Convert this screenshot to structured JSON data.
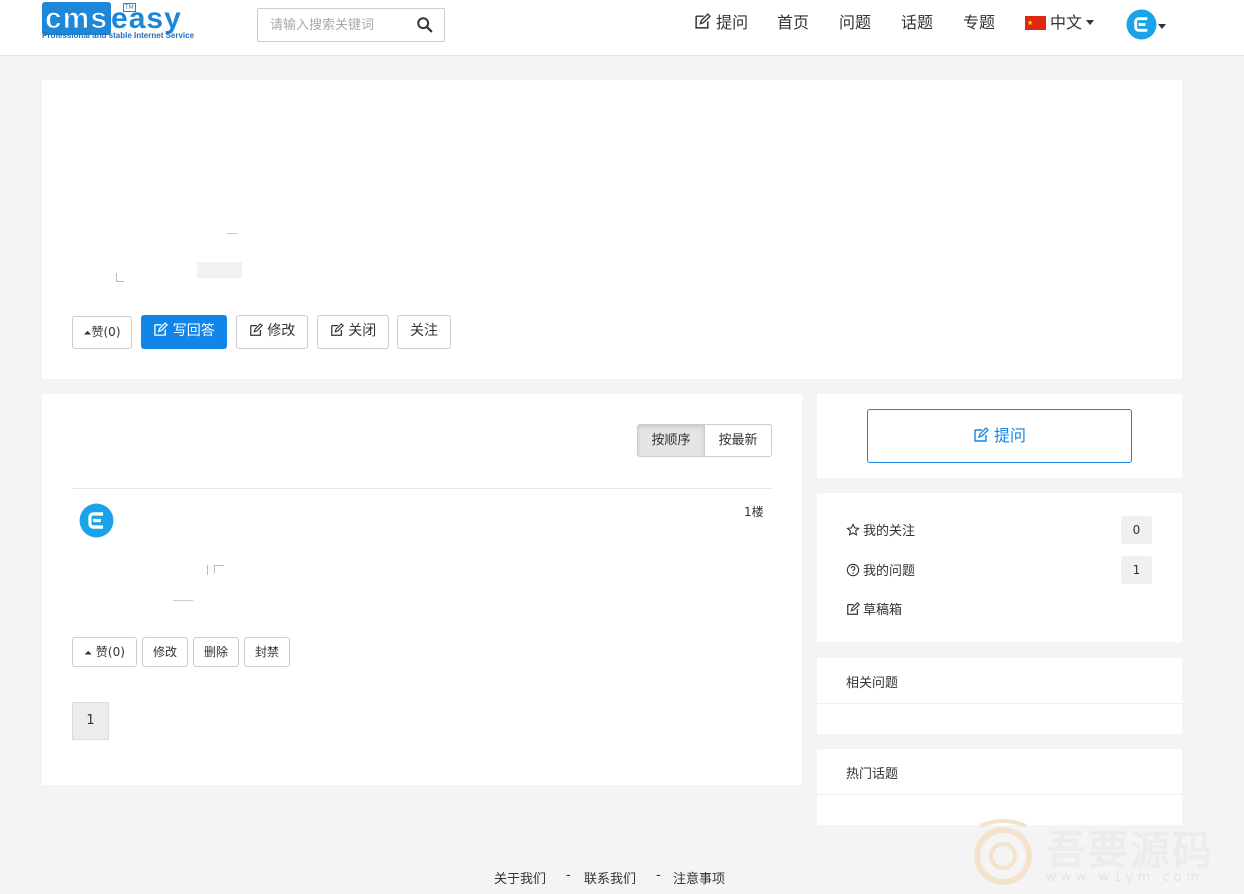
{
  "header": {
    "logo": {
      "brand_a": "cms",
      "brand_b": "easy",
      "tagline": "Professional and stable Internet Service",
      "tm": "TM"
    },
    "search": {
      "placeholder": "请输入搜索关键词"
    },
    "nav": {
      "ask": "提问",
      "home": "首页",
      "questions": "问题",
      "topics": "话题",
      "specials": "专题",
      "language": "中文"
    }
  },
  "question": {
    "buttons": {
      "like": "赞(0)",
      "write_answer": "写回答",
      "edit": "修改",
      "close": "关闭",
      "follow": "关注"
    }
  },
  "answers": {
    "sort": {
      "by_order": "按顺序",
      "by_latest": "按最新"
    },
    "items": [
      {
        "floor": "1楼",
        "buttons": {
          "like": "赞(0)",
          "edit": "修改",
          "delete": "删除",
          "ban": "封禁"
        }
      }
    ],
    "pagination": {
      "current": "1"
    }
  },
  "sidebar": {
    "ask_button": "提问",
    "my_follow": {
      "label": "我的关注",
      "count": "0"
    },
    "my_questions": {
      "label": "我的问题",
      "count": "1"
    },
    "drafts": {
      "label": "草稿箱"
    },
    "related_title": "相关问题",
    "hot_topics_title": "热门话题"
  },
  "footer": {
    "about": "关于我们",
    "contact": "联系我们",
    "notice": "注意事项",
    "sep": "-"
  },
  "watermark": {
    "text": "吾要源码",
    "url": "w w w . w 1 y m . c o m"
  },
  "colors": {
    "primary": "#0f86e8",
    "avatar": "#1aa3e8",
    "background": "#f4f4f4"
  }
}
